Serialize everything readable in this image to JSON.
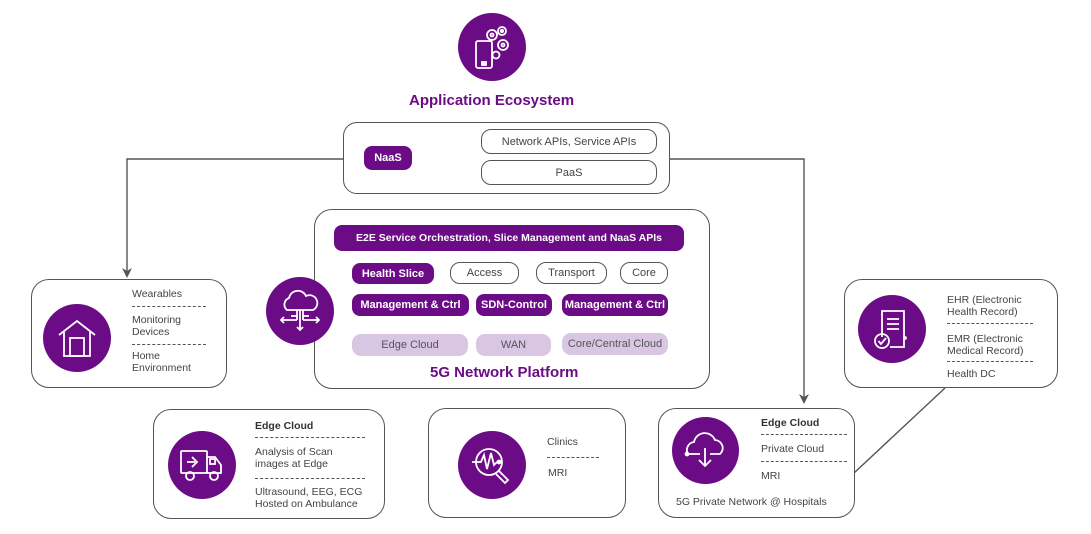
{
  "colors": {
    "brand_purple": "#6b0c86",
    "light_lavender": "#d8c6e3",
    "line_gray": "#555555"
  },
  "app_ecosystem": {
    "icon": "mobile-gears-icon",
    "title": "Application Ecosystem",
    "naas_label": "NaaS",
    "api_items": [
      "Network APIs, Service APIs",
      "PaaS"
    ]
  },
  "network_platform": {
    "icon": "cloud-network-icon",
    "title": "5G Network Platform",
    "orchestration_label": "E2E Service Orchestration, Slice Management and NaaS APIs",
    "slice_row": [
      "Health Slice",
      "Access",
      "Transport",
      "Core"
    ],
    "control_row": [
      "Management & Ctrl",
      "SDN-Control",
      "Management & Ctrl"
    ],
    "cloud_row": [
      "Edge Cloud",
      "WAN",
      "Core/Central Cloud"
    ]
  },
  "home": {
    "icon": "home-icon",
    "items": [
      "Wearables",
      "Monitoring\nDevices",
      "Home\nEnvironment"
    ]
  },
  "records": {
    "icon": "medical-record-check-icon",
    "items": [
      "EHR (Electronic\nHealth Record)",
      "EMR (Electronic\nMedical Record)",
      "Health DC"
    ]
  },
  "ambulance": {
    "icon": "ambulance-truck-icon",
    "heading": "Edge Cloud",
    "items": [
      "Analysis of Scan\nimages at Edge",
      "Ultrasound, EEG, ECG\nHosted on Ambulance"
    ]
  },
  "clinics": {
    "icon": "diagnostic-search-icon",
    "items": [
      "Clinics",
      "MRI"
    ]
  },
  "hospital": {
    "icon": "cloud-download-icon",
    "heading": "Edge Cloud",
    "items": [
      "Private Cloud",
      "MRI"
    ],
    "caption": "5G Private Network @ Hospitals"
  }
}
